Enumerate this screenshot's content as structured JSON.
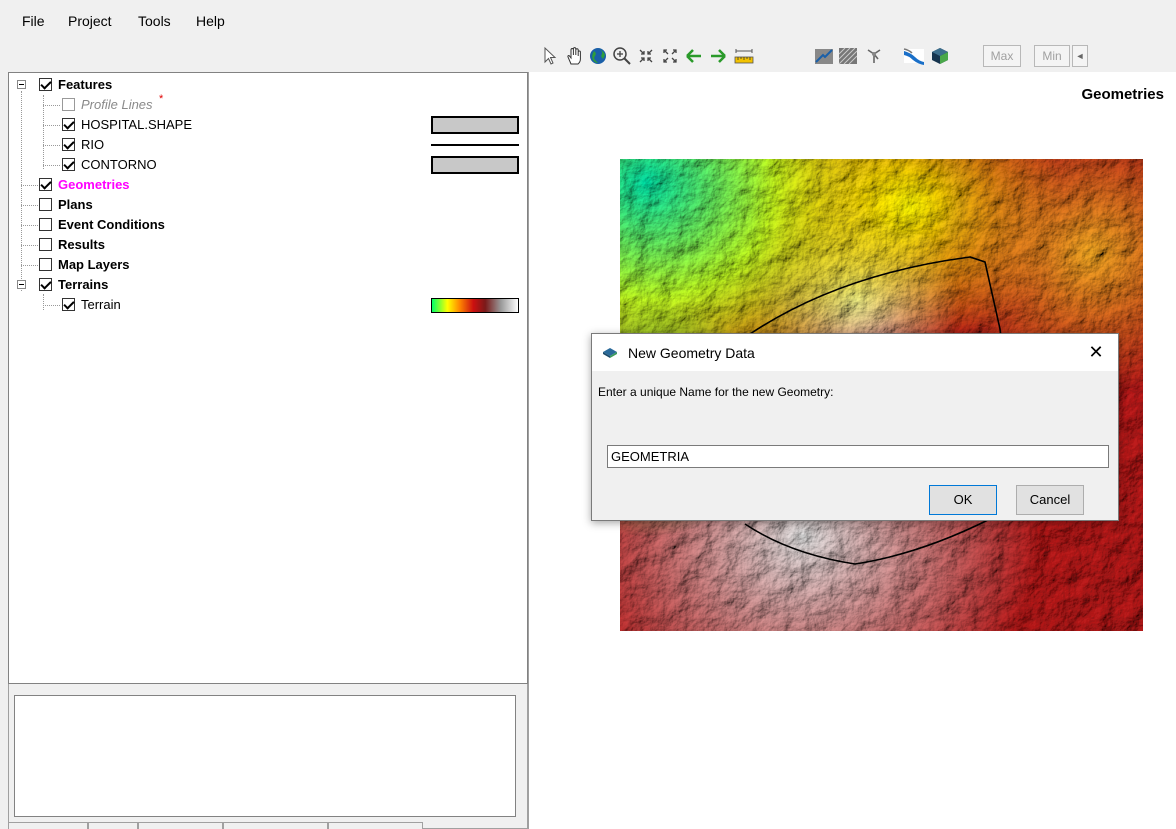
{
  "menu": {
    "items": [
      "File",
      "Project",
      "Tools",
      "Help"
    ]
  },
  "toolbar": {
    "icons": [
      "select-arrow-icon",
      "pan-hand-icon",
      "globe-icon",
      "zoom-in-icon",
      "zoom-out-icon",
      "zoom-extents-icon",
      "back-arrow-icon",
      "forward-arrow-icon",
      "measure-ruler-icon",
      "profile-line-icon",
      "raster-hatch-icon",
      "rotate-icon",
      "river-icon",
      "3d-cube-icon"
    ],
    "max_label": "Max",
    "min_label": "Min",
    "scroll_left_label": "◄"
  },
  "tree": {
    "features": {
      "label": "Features",
      "checked": true
    },
    "profile_lines": {
      "label": "Profile Lines",
      "marker": "*",
      "checked": false
    },
    "hospital": {
      "label": "HOSPITAL.SHAPE",
      "checked": true
    },
    "rio": {
      "label": "RIO",
      "checked": true
    },
    "contorno": {
      "label": "CONTORNO",
      "checked": true
    },
    "geometries": {
      "label": "Geometries",
      "checked": true,
      "color": "#ff00ff"
    },
    "plans": {
      "label": "Plans",
      "checked": false
    },
    "event_conditions": {
      "label": "Event Conditions",
      "checked": false
    },
    "results": {
      "label": "Results",
      "checked": false
    },
    "map_layers": {
      "label": "Map Layers",
      "checked": false
    },
    "terrains": {
      "label": "Terrains",
      "checked": true
    },
    "terrain": {
      "label": "Terrain",
      "checked": true
    }
  },
  "map": {
    "title": "Geometries"
  },
  "dialog": {
    "title": "New Geometry Data",
    "close_label": "✕",
    "prompt": "Enter a unique Name for the new Geometry:",
    "input_value": "GEOMETRIA",
    "ok_label": "OK",
    "cancel_label": "Cancel"
  },
  "colors": {
    "accent": "#0078d7",
    "geometries_label": "#ff00ff"
  }
}
